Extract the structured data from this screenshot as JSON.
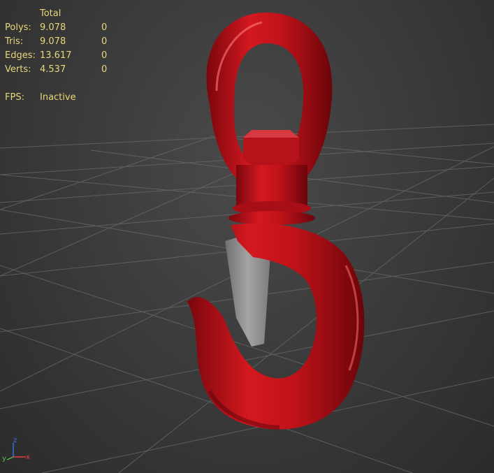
{
  "stats": {
    "header": "Total",
    "rows": [
      {
        "label": "Polys:",
        "total": "9.078",
        "selected": "0"
      },
      {
        "label": "Tris:",
        "total": "9.078",
        "selected": "0"
      },
      {
        "label": "Edges:",
        "total": "13.617",
        "selected": "0"
      },
      {
        "label": "Verts:",
        "total": "4.537",
        "selected": "0"
      }
    ],
    "fps_label": "FPS:",
    "fps_value": "Inactive"
  },
  "axis_gizmo": {
    "z_label": "z",
    "x_label": "x",
    "y_label": "y"
  },
  "colors": {
    "stats_text": "#e8d77a",
    "hook_red": "#c8141c",
    "latch_gray": "#8e8e8e",
    "grid": "#6a6a6a"
  }
}
